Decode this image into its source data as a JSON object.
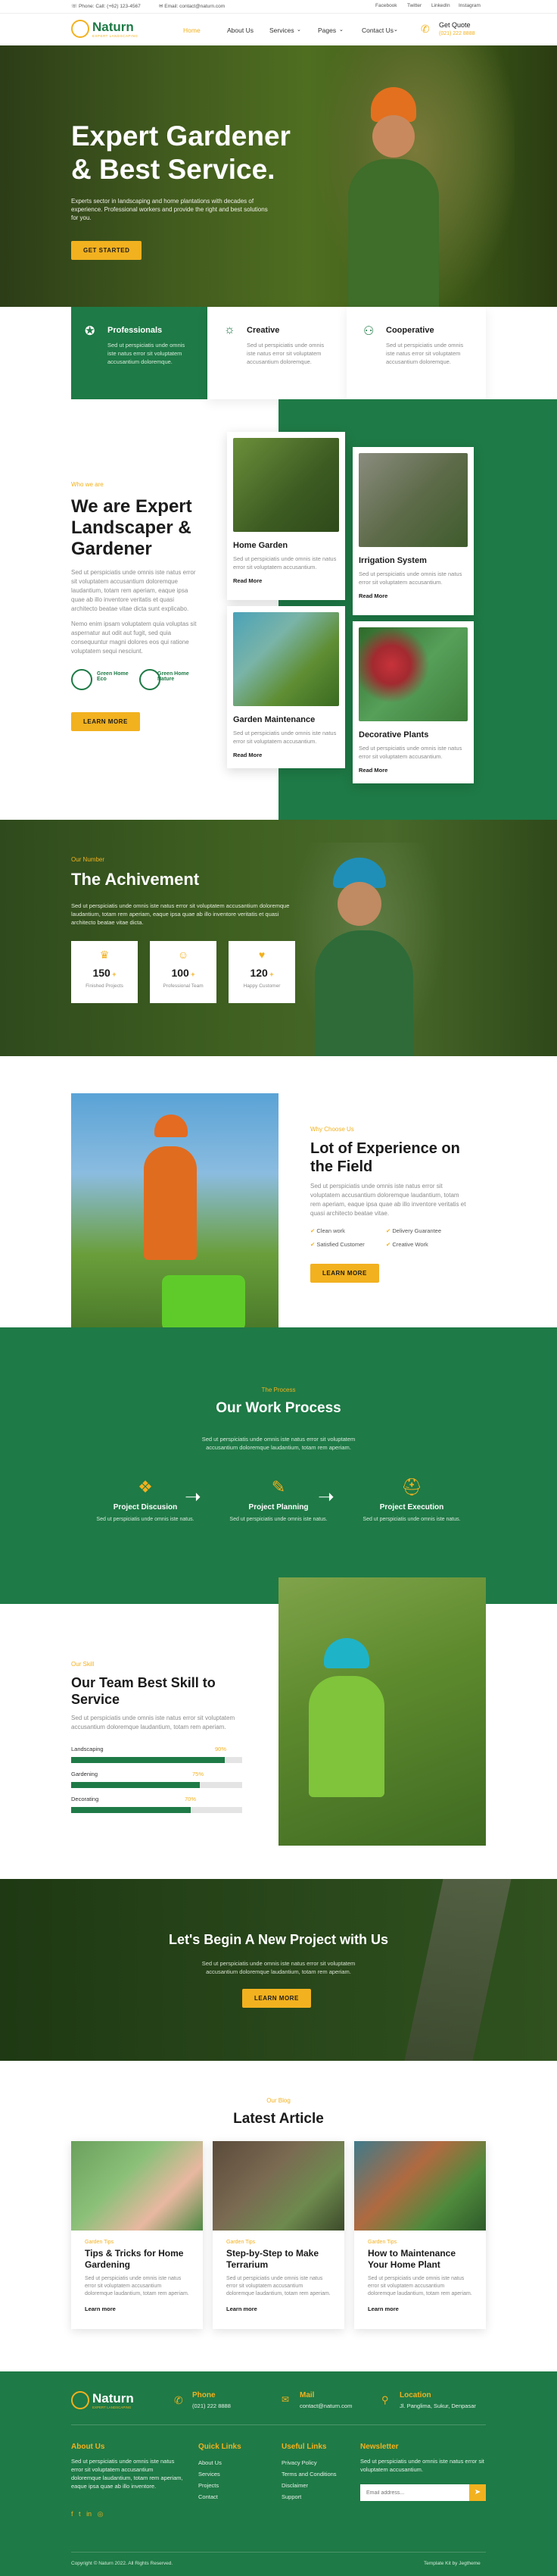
{
  "topbar": {
    "phone": "Phone: Call: (+62) 123-4567",
    "email": "Email: contact@naturn.com",
    "social": [
      "Facebook",
      "Twitter",
      "LinkedIn",
      "Instagram"
    ]
  },
  "brand": {
    "name": "Naturn",
    "tagline": "EXPERT LANDSCAPING"
  },
  "nav": {
    "items": [
      "Home",
      "About Us",
      "Services",
      "Pages",
      "Contact Us"
    ],
    "quote_title": "Get Quote",
    "quote_phone": "(021) 222 8888"
  },
  "hero": {
    "title_line1": "Expert Gardener",
    "title_line2": "& Best Service.",
    "desc": "Experts sector in landscaping and home plantations with decades of experience. Professional workers and provide the right and best solutions for you.",
    "button": "GET STARTED"
  },
  "features": [
    {
      "title": "Professionals",
      "desc": "Sed ut perspiciatis unde omnis iste natus error sit voluptatem accusantium doloremque."
    },
    {
      "title": "Creative",
      "desc": "Sed ut perspiciatis unde omnis iste natus error sit voluptatem accusantium doloremque."
    },
    {
      "title": "Cooperative",
      "desc": "Sed ut perspiciatis unde omnis iste natus error sit voluptatem accusantium doloremque."
    }
  ],
  "about": {
    "tag": "Who we are",
    "title": "We are Expert Landscaper & Gardener",
    "desc1": "Sed ut perspiciatis unde omnis iste natus error sit voluptatem accusantium doloremque laudantium, totam rem aperiam, eaque ipsa quae ab illo inventore veritatis et quasi architecto beatae vitae dicta sunt explicabo.",
    "desc2": "Nemo enim ipsam voluptatem quia voluptas sit aspernatur aut odit aut fugit, sed quia consequuntur magni dolores eos qui ratione voluptatem sequi nesciunt.",
    "badge1": "Green Home Eco",
    "badge2": "Green Home Nature",
    "button": "LEARN MORE"
  },
  "services": [
    {
      "title": "Home Garden",
      "desc": "Sed ut perspiciatis unde omnis iste natus error sit voluptatem accusantium.",
      "link": "Read More"
    },
    {
      "title": "Irrigation System",
      "desc": "Sed ut perspiciatis unde omnis iste natus error sit voluptatem accusantium.",
      "link": "Read More"
    },
    {
      "title": "Garden Maintenance",
      "desc": "Sed ut perspiciatis unde omnis iste natus error sit voluptatem accusantium.",
      "link": "Read More"
    },
    {
      "title": "Decorative Plants",
      "desc": "Sed ut perspiciatis unde omnis iste natus error sit voluptatem accusantium.",
      "link": "Read More"
    }
  ],
  "achievement": {
    "tag": "Our Number",
    "title": "The Achivement",
    "desc": "Sed ut perspiciatis unde omnis iste natus error sit voluptatem accusantium doloremque laudantium, totam rem aperiam, eaque ipsa quae ab illo inventore veritatis et quasi architecto beatae vitae dicta.",
    "stats": [
      {
        "num": "150",
        "label": "Finished Projects"
      },
      {
        "num": "100",
        "label": "Professional Team"
      },
      {
        "num": "120",
        "label": "Happy Customer"
      }
    ]
  },
  "experience": {
    "tag": "Why Choose Us",
    "title": "Lot of Experience on the Field",
    "desc": "Sed ut perspiciatis unde omnis iste natus error sit voluptatem accusantium doloremque laudantium, totam rem aperiam, eaque ipsa quae ab illo inventore veritatis et quasi architecto beatae vitae.",
    "checks": [
      "Clean work",
      "Delivery Guarantee",
      "Satisfied Customer",
      "Creative Work"
    ],
    "button": "LEARN MORE"
  },
  "process": {
    "tag": "The Process",
    "title": "Our Work Process",
    "desc": "Sed ut perspiciatis unde omnis iste natus error sit voluptatem accusantium doloremque laudantium, totam rem aperiam.",
    "steps": [
      {
        "title": "Project Discusion",
        "desc": "Sed ut perspiciatis unde omnis iste natus."
      },
      {
        "title": "Project Planning",
        "desc": "Sed ut perspiciatis unde omnis iste natus."
      },
      {
        "title": "Project Execution",
        "desc": "Sed ut perspiciatis unde omnis iste natus."
      }
    ]
  },
  "skills": {
    "tag": "Our Skill",
    "title": "Our Team Best Skill to Service",
    "desc": "Sed ut perspiciatis unde omnis iste natus error sit voluptatem accusantium doloremque laudantium, totam rem aperiam.",
    "items": [
      {
        "label": "Landscaping",
        "pct": "90%",
        "value": 0.9
      },
      {
        "label": "Gardening",
        "pct": "75%",
        "value": 0.75
      },
      {
        "label": "Decorating",
        "pct": "70%",
        "value": 0.7
      }
    ]
  },
  "cta": {
    "title": "Let's Begin A New Project with Us",
    "desc": "Sed ut perspiciatis unde omnis iste natus error sit voluptatem accusantium doloremque laudantium, totam rem aperiam.",
    "button": "LEARN MORE"
  },
  "blog": {
    "tag": "Our Blog",
    "title": "Latest Article",
    "articles": [
      {
        "tag": "Garden Tips",
        "title": "Tips & Tricks for Home Gardening",
        "desc": "Sed ut perspiciatis unde omnis iste natus error sit voluptatem accusantium doloremque laudantium, totam rem aperiam.",
        "link": "Learn more"
      },
      {
        "tag": "Garden Tips",
        "title": "Step-by-Step to Make Terrarium",
        "desc": "Sed ut perspiciatis unde omnis iste natus error sit voluptatem accusantium doloremque laudantium, totam rem aperiam.",
        "link": "Learn more"
      },
      {
        "tag": "Garden Tips",
        "title": "How to Maintenance Your Home Plant",
        "desc": "Sed ut perspiciatis unde omnis iste natus error sit voluptatem accusantium doloremque laudantium, totam rem aperiam.",
        "link": "Learn more"
      }
    ]
  },
  "footer": {
    "phone_label": "Phone",
    "phone": "(021) 222 8888",
    "mail_label": "Mail",
    "mail": "contact@naturn.com",
    "loc_label": "Location",
    "loc": "Jl. Panglima, Sukur, Denpasar",
    "about_title": "About Us",
    "about_desc": "Sed ut perspiciatis unde omnis iste natus error sit voluptatem accusantium doloremque laudantium, totam rem aperiam, eaque ipsa quae ab illo inventore.",
    "quick_title": "Quick Links",
    "quick": [
      "About Us",
      "Services",
      "Projects",
      "Contact"
    ],
    "useful_title": "Useful Links",
    "useful": [
      "Privacy Policy",
      "Terms and Conditions",
      "Disclaimer",
      "Support"
    ],
    "news_title": "Newsletter",
    "news_desc": "Sed ut perspiciatis unde omnis iste natus error sit voluptatem accusantium.",
    "news_placeholder": "Email address...",
    "copyright": "Copyright © Naturn 2022. All Rights Reserved.",
    "credit": "Template Kit by Jegtheme"
  },
  "colors": {
    "primary": "#1e7a46",
    "accent": "#f2b11f"
  }
}
